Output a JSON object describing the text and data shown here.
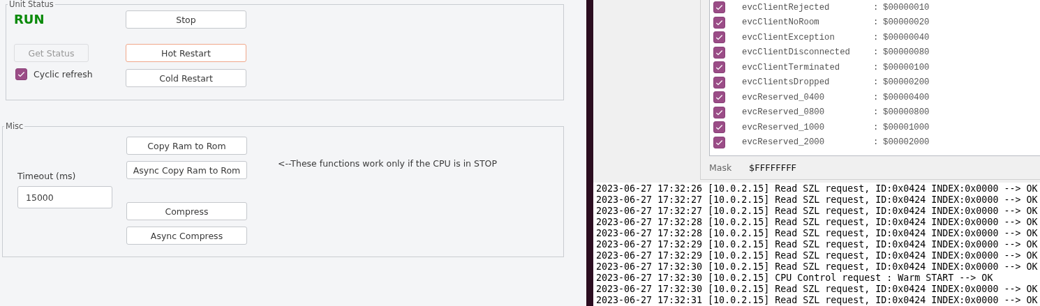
{
  "unit_status": {
    "legend": "Unit Status",
    "status": {
      "text": "RUN",
      "running": true
    },
    "buttons": [
      {
        "label": "Stop",
        "disabled": false,
        "focused": false
      },
      {
        "label": "Get Status",
        "disabled": true,
        "focused": false
      },
      {
        "label": "Hot Restart",
        "disabled": false,
        "focused": true
      },
      {
        "label": "Cold Restart",
        "disabled": false,
        "focused": false
      }
    ],
    "cyclic_refresh": {
      "label": "Cyclic refresh",
      "checked": true
    }
  },
  "misc": {
    "legend": "Misc",
    "timeout": {
      "label": "Timeout (ms)",
      "value": "15000"
    },
    "buttons": [
      {
        "label": "Copy Ram to Rom"
      },
      {
        "label": "Async Copy Ram to Rom"
      },
      {
        "label": "Compress"
      },
      {
        "label": "Async Compress"
      }
    ],
    "note": "<--These functions work only if the CPU is in STOP"
  },
  "event_mask": {
    "events": [
      {
        "name": "evcClientRejected",
        "separator": ":",
        "value": "$00000010",
        "checked": true
      },
      {
        "name": "evcClientNoRoom",
        "separator": ":",
        "value": "$00000020",
        "checked": true
      },
      {
        "name": "evcClientException",
        "separator": ":",
        "value": "$00000040",
        "checked": true
      },
      {
        "name": "evcClientDisconnected",
        "separator": ":",
        "value": "$00000080",
        "checked": true
      },
      {
        "name": "evcClientTerminated",
        "separator": ":",
        "value": "$00000100",
        "checked": true
      },
      {
        "name": "evcClientsDropped",
        "separator": ":",
        "value": "$00000200",
        "checked": true
      },
      {
        "name": "evcReserved_0400",
        "separator": ":",
        "value": "$00000400",
        "checked": true
      },
      {
        "name": "evcReserved_0800",
        "separator": ":",
        "value": "$00000800",
        "checked": true
      },
      {
        "name": "evcReserved_1000",
        "separator": ":",
        "value": "$00001000",
        "checked": true
      },
      {
        "name": "evcReserved_2000",
        "separator": ":",
        "value": "$00002000",
        "checked": true
      }
    ],
    "mask": {
      "label": "Mask",
      "value": "$FFFFFFFF"
    }
  },
  "log": [
    "2023-06-27 17:32:26 [10.0.2.15] Read SZL request, ID:0x0424 INDEX:0x0000 --> OK",
    "2023-06-27 17:32:27 [10.0.2.15] Read SZL request, ID:0x0424 INDEX:0x0000 --> OK",
    "2023-06-27 17:32:27 [10.0.2.15] Read SZL request, ID:0x0424 INDEX:0x0000 --> OK",
    "2023-06-27 17:32:28 [10.0.2.15] Read SZL request, ID:0x0424 INDEX:0x0000 --> OK",
    "2023-06-27 17:32:28 [10.0.2.15] Read SZL request, ID:0x0424 INDEX:0x0000 --> OK",
    "2023-06-27 17:32:29 [10.0.2.15] Read SZL request, ID:0x0424 INDEX:0x0000 --> OK",
    "2023-06-27 17:32:29 [10.0.2.15] Read SZL request, ID:0x0424 INDEX:0x0000 --> OK",
    "2023-06-27 17:32:30 [10.0.2.15] Read SZL request, ID:0x0424 INDEX:0x0000 --> OK",
    "2023-06-27 17:32:30 [10.0.2.15] CPU Control request : Warm START --> OK",
    "2023-06-27 17:32:30 [10.0.2.15] Read SZL request, ID:0x0424 INDEX:0x0000 --> OK",
    "2023-06-27 17:32:31 [10.0.2.15] Read SZL request, ID:0x0424 INDEX:0x0000 --> OK"
  ]
}
